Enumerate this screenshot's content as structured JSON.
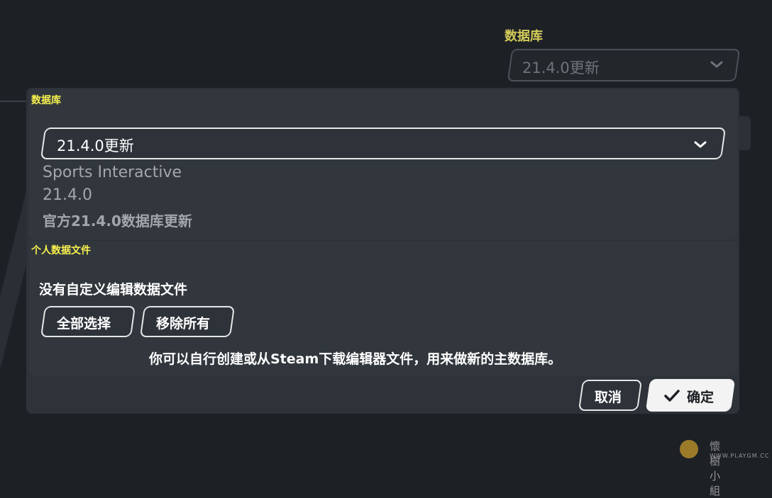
{
  "background": {
    "database_label": "数据库",
    "database_value": "21.4.0更新"
  },
  "dialog": {
    "database_section": {
      "title": "数据库",
      "selected": "21.4.0更新",
      "publisher": "Sports Interactive",
      "version": "21.4.0",
      "description": "官方21.4.0数据库更新"
    },
    "personal_section": {
      "title": "个人数据文件",
      "empty_message": "没有自定义编辑数据文件",
      "select_all_label": "全部选择",
      "remove_all_label": "移除所有",
      "hint": "你可以自行创建或从Steam下载编辑器文件，用来做新的主数据库。"
    },
    "cancel_label": "取消",
    "confirm_label": "确定"
  },
  "watermark": {
    "cn": "懷樹小組",
    "en": "WWW.PLAYGM.CC"
  },
  "colors": {
    "accent_yellow": "#f7f04f",
    "panel_bg": "#31373d",
    "dialog_bg": "#2d3339"
  }
}
